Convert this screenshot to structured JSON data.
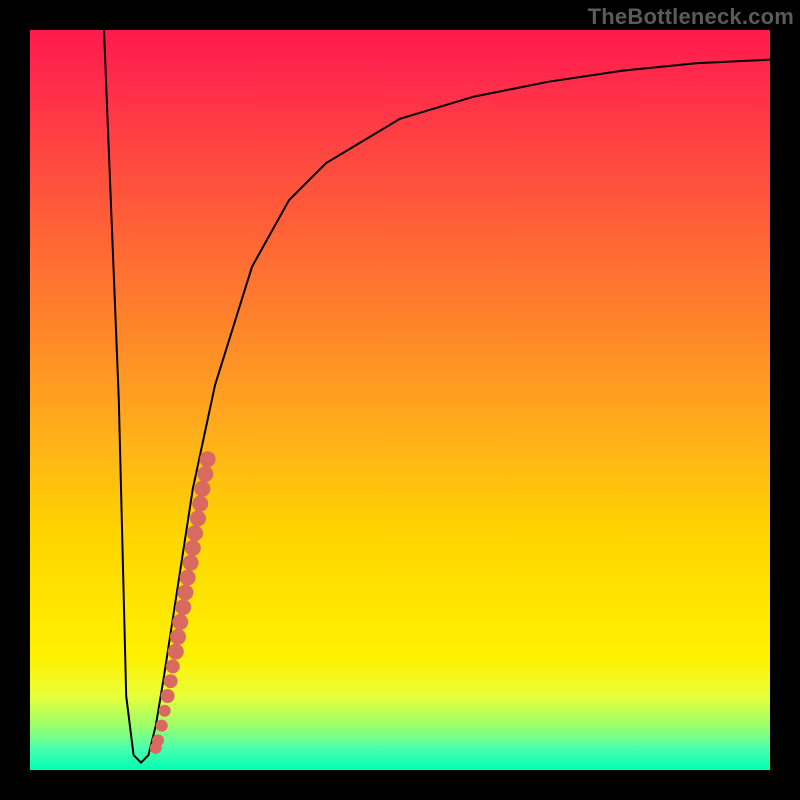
{
  "watermark": "TheBottleneck.com",
  "chart_data": {
    "type": "line",
    "title": "",
    "xlabel": "",
    "ylabel": "",
    "xlim": [
      0,
      100
    ],
    "ylim": [
      0,
      100
    ],
    "series": [
      {
        "name": "bottleneck-curve",
        "x": [
          10,
          12,
          13,
          14,
          15,
          16,
          17,
          18,
          20,
          22,
          25,
          30,
          35,
          40,
          50,
          60,
          70,
          80,
          90,
          100
        ],
        "values": [
          100,
          50,
          10,
          2,
          1,
          2,
          6,
          12,
          25,
          38,
          52,
          68,
          77,
          82,
          88,
          91,
          93,
          94.5,
          95.5,
          96
        ]
      }
    ],
    "markers": {
      "name": "highlighted-segment",
      "x": [
        17.0,
        17.3,
        17.8,
        18.2,
        18.6,
        19.0,
        19.3,
        19.7,
        20.0,
        20.3,
        20.7,
        21.0,
        21.3,
        21.7,
        22.0,
        22.3,
        22.7,
        23.0,
        23.3,
        23.7,
        24.0
      ],
      "values": [
        3,
        4,
        6,
        8,
        10,
        12,
        14,
        16,
        18,
        20,
        22,
        24,
        26,
        28,
        30,
        32,
        34,
        36,
        38,
        40,
        42
      ],
      "sizes": [
        6,
        6,
        6,
        6,
        7,
        7,
        7,
        8,
        8,
        8,
        8,
        8,
        8,
        8,
        8,
        8,
        8,
        8,
        8,
        8,
        8
      ]
    },
    "gradient_stops": [
      {
        "pos": 0.0,
        "color": "#ff1a4d"
      },
      {
        "pos": 0.3,
        "color": "#ff6a34"
      },
      {
        "pos": 0.68,
        "color": "#ffd400"
      },
      {
        "pos": 0.9,
        "color": "#e8ff3a"
      },
      {
        "pos": 1.0,
        "color": "#00ffb3"
      }
    ]
  }
}
